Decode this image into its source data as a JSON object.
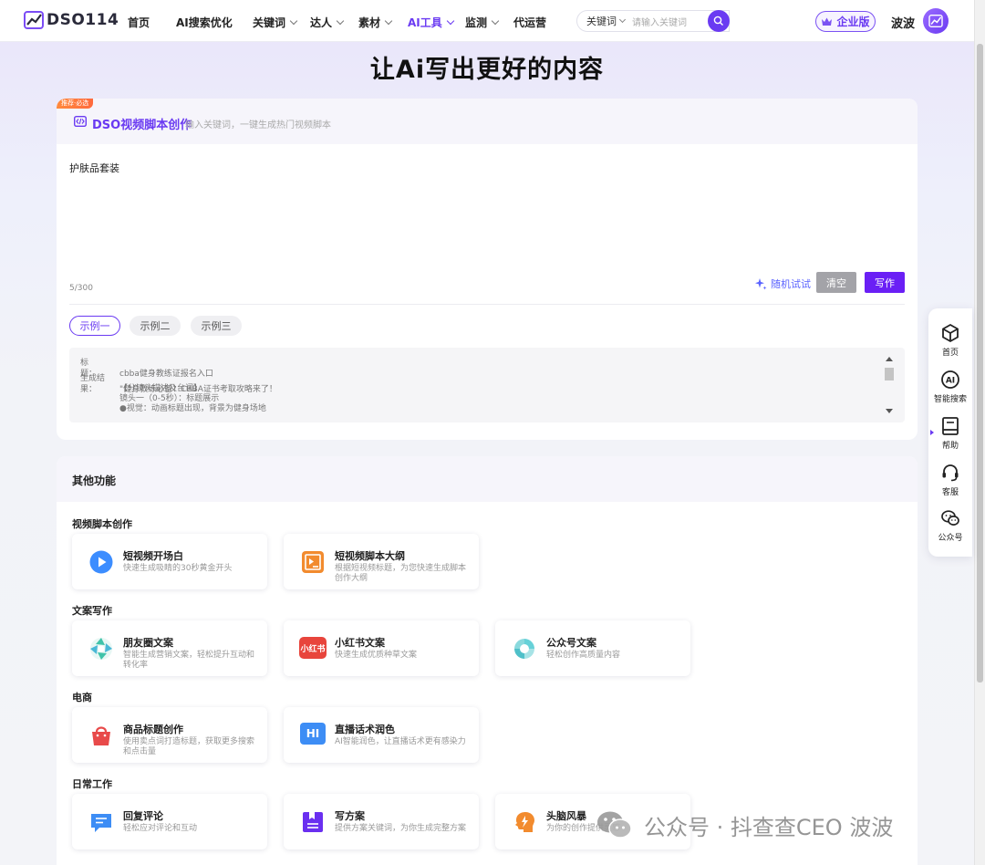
{
  "nav": {
    "logo_text": "DSO114",
    "items": [
      {
        "label": "首页",
        "dropdown": false
      },
      {
        "label": "AI搜索优化",
        "dropdown": false
      },
      {
        "label": "关键词",
        "dropdown": true
      },
      {
        "label": "达人",
        "dropdown": true
      },
      {
        "label": "素材",
        "dropdown": true
      },
      {
        "label": "AI工具",
        "dropdown": true,
        "active": true
      },
      {
        "label": "监测",
        "dropdown": true
      },
      {
        "label": "代运营",
        "dropdown": false
      }
    ],
    "search_category": "关键词",
    "search_placeholder": "请输入关键词",
    "enterprise_label": "企业版",
    "username": "波波",
    "accent_color": "#6a3af2"
  },
  "hero_title": "让Ai写出更好的内容",
  "tool": {
    "badge": "推荐·必选",
    "title": "DSO视频脚本创作",
    "subtitle": "输入关键词，一键生成热门视频脚本",
    "input_value": "护肤品套装",
    "counter": "5/300",
    "random_label": "随机试试",
    "clear_label": "清空",
    "write_label": "写作",
    "example_tabs": [
      "示例一",
      "示例二",
      "示例三"
    ],
    "example": {
      "title_label": "标　　题：",
      "title_value": "cbba健身教练证报名入口",
      "result_label": "生成结果：",
      "lines": [
        "\"健身教练必备！CBBA证书考取攻略来了！",
        "【分镜头描述及台词】",
        "镜头一（0-5秒）：标题展示",
        "●视觉：动画标题出现，背景为健身场地"
      ]
    }
  },
  "other": {
    "title": "其他功能",
    "sections": [
      {
        "name": "视频脚本创作",
        "items": [
          {
            "name": "短视频开场白",
            "desc": "快速生成吸睛的30秒黄金开头",
            "icon": "play-icon"
          },
          {
            "name": "短视频脚本大纲",
            "desc": "根据短视频标题，为您快速生成脚本创作大纲",
            "icon": "outline-icon"
          }
        ]
      },
      {
        "name": "文案写作",
        "items": [
          {
            "name": "朋友圈文案",
            "desc": "智能生成营销文案，轻松提升互动和转化率",
            "icon": "aperture-icon"
          },
          {
            "name": "小红书文案",
            "desc": "快速生成优质种草文案",
            "icon": "xiaohongshu-icon",
            "icon_text": "小红书"
          },
          {
            "name": "公众号文案",
            "desc": "轻松创作高质量内容",
            "icon": "wechat-mp-icon"
          }
        ]
      },
      {
        "name": "电商",
        "items": [
          {
            "name": "商品标题创作",
            "desc": "使用卖点词打造标题，获取更多搜索和点击量",
            "icon": "shopping-bag-icon"
          },
          {
            "name": "直播话术润色",
            "desc": "AI智能润色，让直播话术更有感染力",
            "icon": "hi-chat-icon",
            "icon_text": "HI"
          }
        ]
      },
      {
        "name": "日常工作",
        "items": [
          {
            "name": "回复评论",
            "desc": "轻松应对评论和互动",
            "icon": "comment-icon"
          },
          {
            "name": "写方案",
            "desc": "提供方案关键词，为你生成完整方案",
            "icon": "plan-icon"
          },
          {
            "name": "头脑风暴",
            "desc": "为你的创作提供灵感",
            "icon": "brain-icon"
          }
        ]
      }
    ]
  },
  "sidebar": [
    {
      "label": "首页",
      "icon": "cube-icon"
    },
    {
      "label": "智能搜索",
      "icon": "ai-icon"
    },
    {
      "label": "帮助",
      "icon": "book-icon"
    },
    {
      "label": "客服",
      "icon": "headset-icon"
    },
    {
      "label": "公众号",
      "icon": "wechat-icon"
    }
  ],
  "watermark": "公众号 · 抖查查CEO 波波"
}
